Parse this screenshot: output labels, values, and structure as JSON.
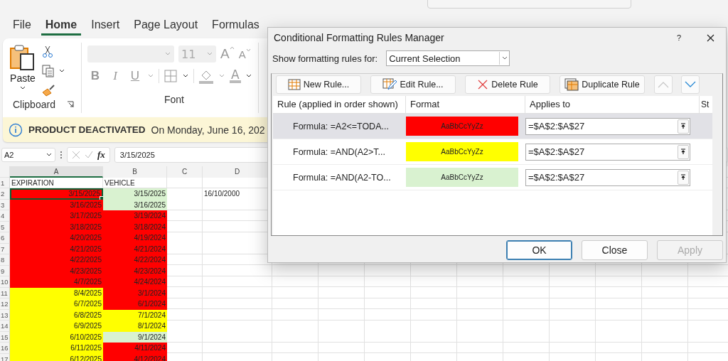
{
  "menu_tabs": [
    {
      "label": "File",
      "selected": false
    },
    {
      "label": "Home",
      "selected": true
    },
    {
      "label": "Insert",
      "selected": false
    },
    {
      "label": "Page Layout",
      "selected": false
    },
    {
      "label": "Formulas",
      "selected": false
    }
  ],
  "ribbon": {
    "clipboard": {
      "label": "Clipboard",
      "paste": "Paste"
    },
    "font": {
      "label": "Font",
      "size": "11",
      "grow": "A",
      "shrink": "A",
      "styles": [
        "B",
        "I",
        "U"
      ],
      "font_color": "A"
    }
  },
  "notification": {
    "title": "PRODUCT DEACTIVATED",
    "message": "On Monday, June 16, 202"
  },
  "formula_bar": {
    "name_box": "A2",
    "fx": "fx",
    "value": "3/15/2025"
  },
  "sheet": {
    "columns": [
      "A",
      "B",
      "C",
      "D"
    ],
    "rows": [
      {
        "num": "1",
        "a": {
          "text": "EXPIRATION",
          "selected": false
        },
        "b": {
          "text": "VEHICLE",
          "selected": false
        }
      },
      {
        "num": "2",
        "a": {
          "text": "3/15/2025",
          "color": "#ff0000",
          "selected": true
        },
        "b": {
          "text": "3/15/2025",
          "color": "#d9f2d0",
          "selected": false
        },
        "d": "16/10/2000"
      },
      {
        "num": "3",
        "a": {
          "text": "3/16/2025",
          "color": "#ff0000",
          "selected": false
        },
        "b": {
          "text": "3/16/2025",
          "color": "#d9f2d0",
          "selected": false
        }
      },
      {
        "num": "4",
        "a": {
          "text": "3/17/2025",
          "color": "#ff0000",
          "selected": false
        },
        "b": {
          "text": "3/19/2024",
          "color": "#ff0000",
          "selected": false
        }
      },
      {
        "num": "5",
        "a": {
          "text": "3/18/2025",
          "color": "#ff0000",
          "selected": false
        },
        "b": {
          "text": "3/18/2024",
          "color": "#ff0000",
          "selected": false
        }
      },
      {
        "num": "6",
        "a": {
          "text": "4/20/2025",
          "color": "#ff0000",
          "selected": false
        },
        "b": {
          "text": "4/19/2024",
          "color": "#ff0000",
          "selected": false
        }
      },
      {
        "num": "7",
        "a": {
          "text": "4/21/2025",
          "color": "#ff0000",
          "selected": false
        },
        "b": {
          "text": "4/21/2024",
          "color": "#ff0000",
          "selected": false
        }
      },
      {
        "num": "8",
        "a": {
          "text": "4/22/2025",
          "color": "#ff0000",
          "selected": false
        },
        "b": {
          "text": "4/22/2024",
          "color": "#ff0000",
          "selected": false
        }
      },
      {
        "num": "9",
        "a": {
          "text": "4/23/2025",
          "color": "#ff0000",
          "selected": false
        },
        "b": {
          "text": "4/23/2024",
          "color": "#ff0000",
          "selected": false
        }
      },
      {
        "num": "10",
        "a": {
          "text": "4/7/2025",
          "color": "#ff0000",
          "selected": false
        },
        "b": {
          "text": "4/24/2024",
          "color": "#ff0000",
          "selected": false
        }
      },
      {
        "num": "11",
        "a": {
          "text": "8/4/2025",
          "color": "#ffff00",
          "selected": false
        },
        "b": {
          "text": "3/1/2024",
          "color": "#ff0000",
          "selected": false
        }
      },
      {
        "num": "12",
        "a": {
          "text": "6/7/2025",
          "color": "#ffff00",
          "selected": false
        },
        "b": {
          "text": "6/1/2024",
          "color": "#ff0000",
          "selected": false
        }
      },
      {
        "num": "13",
        "a": {
          "text": "6/8/2025",
          "color": "#ffff00",
          "selected": false
        },
        "b": {
          "text": "7/1/2024",
          "color": "#ffff00",
          "selected": false
        }
      },
      {
        "num": "14",
        "a": {
          "text": "6/9/2025",
          "color": "#ffff00",
          "selected": false
        },
        "b": {
          "text": "8/1/2024",
          "color": "#ffff00",
          "selected": false
        }
      },
      {
        "num": "15",
        "a": {
          "text": "6/10/2025",
          "color": "#ffff00",
          "selected": false
        },
        "b": {
          "text": "9/1/2024",
          "color": "#d9f2d0",
          "selected": false
        }
      },
      {
        "num": "16",
        "a": {
          "text": "6/11/2025",
          "color": "#ffff00",
          "selected": false
        },
        "b": {
          "text": "4/11/2024",
          "color": "#ff0000",
          "selected": false
        }
      },
      {
        "num": "17",
        "a": {
          "text": "6/12/2025",
          "color": "#ffff00",
          "selected": false
        },
        "b": {
          "text": "4/12/2024",
          "color": "#ff0000",
          "selected": false
        }
      }
    ]
  },
  "dialog": {
    "title": "Conditional Formatting Rules Manager",
    "help": "?",
    "show_label": "Show formatting rules for:",
    "show_value": "Current Selection",
    "toolbar": [
      {
        "label": "New Rule...",
        "kind": "new"
      },
      {
        "label": "Edit Rule...",
        "kind": "edit"
      },
      {
        "label": "Delete Rule",
        "kind": "delete"
      },
      {
        "label": "Duplicate Rule",
        "kind": "duplicate"
      }
    ],
    "move_buttons": [
      {
        "kind": "up",
        "disabled": true
      },
      {
        "kind": "down",
        "disabled": false
      }
    ],
    "columns": [
      "Rule (applied in order shown)",
      "Format",
      "Applies to",
      "St"
    ],
    "rules": [
      {
        "rule": "Formula: =A2<=TODA...",
        "preview": "AaBbCcYyZz",
        "color": "#ff0000",
        "applies_to": "=$A$2:$A$27",
        "selected": true
      },
      {
        "rule": "Formula: =AND(A2>T...",
        "preview": "AaBbCcYyZz",
        "color": "#ffff00",
        "applies_to": "=$A$2:$A$27",
        "selected": false
      },
      {
        "rule": "Formula: =AND(A2-TO...",
        "preview": "AaBbCcYyZz",
        "color": "#d9f2d0",
        "applies_to": "=$A$2:$A$27",
        "selected": false
      }
    ],
    "buttons": [
      {
        "label": "OK",
        "kind": "default",
        "disabled": false
      },
      {
        "label": "Close",
        "kind": "normal",
        "disabled": false
      },
      {
        "label": "Apply",
        "kind": "normal",
        "disabled": true
      }
    ]
  }
}
